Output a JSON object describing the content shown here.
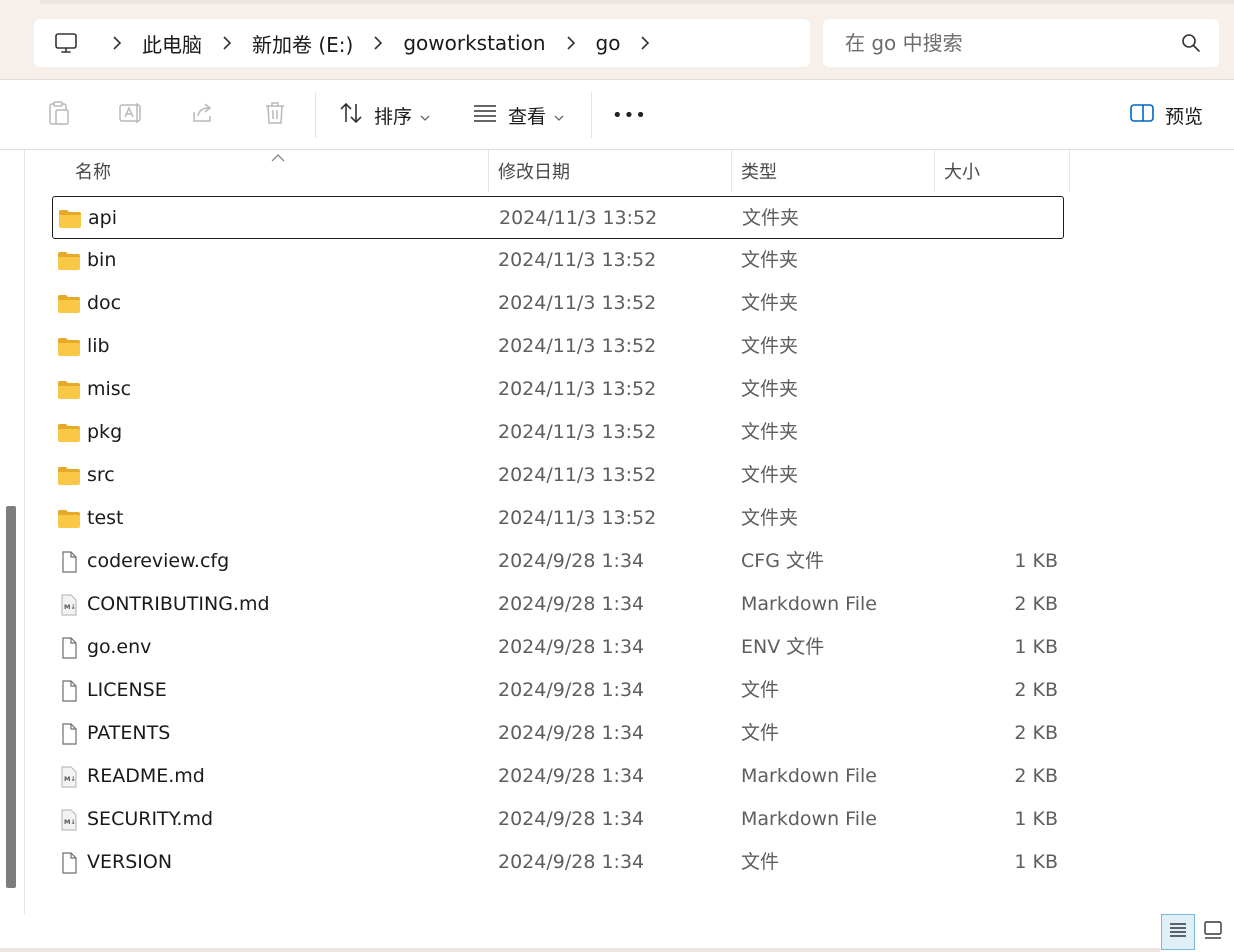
{
  "breadcrumb": {
    "root_icon": "computer-icon",
    "segments": [
      "此电脑",
      "新加卷 (E:)",
      "goworkstation",
      "go"
    ]
  },
  "search": {
    "placeholder": "在 go 中搜索"
  },
  "toolbar": {
    "copy_icon": "clipboard-icon",
    "rename_icon": "rename-icon",
    "share_icon": "share-icon",
    "delete_icon": "trash-icon",
    "sort_label": "排序",
    "view_label": "查看",
    "more_label": "•••",
    "preview_label": "预览"
  },
  "columns": {
    "name": "名称",
    "date": "修改日期",
    "type": "类型",
    "size": "大小"
  },
  "files": [
    {
      "name": "api",
      "date": "2024/11/3 13:52",
      "type": "文件夹",
      "size": "",
      "icon": "folder-icon",
      "selected": true
    },
    {
      "name": "bin",
      "date": "2024/11/3 13:52",
      "type": "文件夹",
      "size": "",
      "icon": "folder-icon"
    },
    {
      "name": "doc",
      "date": "2024/11/3 13:52",
      "type": "文件夹",
      "size": "",
      "icon": "folder-icon"
    },
    {
      "name": "lib",
      "date": "2024/11/3 13:52",
      "type": "文件夹",
      "size": "",
      "icon": "folder-icon"
    },
    {
      "name": "misc",
      "date": "2024/11/3 13:52",
      "type": "文件夹",
      "size": "",
      "icon": "folder-icon"
    },
    {
      "name": "pkg",
      "date": "2024/11/3 13:52",
      "type": "文件夹",
      "size": "",
      "icon": "folder-icon"
    },
    {
      "name": "src",
      "date": "2024/11/3 13:52",
      "type": "文件夹",
      "size": "",
      "icon": "folder-icon"
    },
    {
      "name": "test",
      "date": "2024/11/3 13:52",
      "type": "文件夹",
      "size": "",
      "icon": "folder-icon"
    },
    {
      "name": "codereview.cfg",
      "date": "2024/9/28 1:34",
      "type": "CFG 文件",
      "size": "1 KB",
      "icon": "file-icon"
    },
    {
      "name": "CONTRIBUTING.md",
      "date": "2024/9/28 1:34",
      "type": "Markdown File",
      "size": "2 KB",
      "icon": "markdown-file-icon"
    },
    {
      "name": "go.env",
      "date": "2024/9/28 1:34",
      "type": "ENV 文件",
      "size": "1 KB",
      "icon": "file-icon"
    },
    {
      "name": "LICENSE",
      "date": "2024/9/28 1:34",
      "type": "文件",
      "size": "2 KB",
      "icon": "file-icon"
    },
    {
      "name": "PATENTS",
      "date": "2024/9/28 1:34",
      "type": "文件",
      "size": "2 KB",
      "icon": "file-icon"
    },
    {
      "name": "README.md",
      "date": "2024/9/28 1:34",
      "type": "Markdown File",
      "size": "2 KB",
      "icon": "markdown-file-icon"
    },
    {
      "name": "SECURITY.md",
      "date": "2024/9/28 1:34",
      "type": "Markdown File",
      "size": "1 KB",
      "icon": "markdown-file-icon"
    },
    {
      "name": "VERSION",
      "date": "2024/9/28 1:34",
      "type": "文件",
      "size": "1 KB",
      "icon": "file-icon"
    }
  ],
  "view_modes": [
    "details-view-icon",
    "large-icons-view-icon"
  ],
  "colors": {
    "accent": "#0067c0",
    "folder_yellow": "#f8c846",
    "folder_dark": "#e7a928",
    "chrome_bg": "#f6efea"
  }
}
